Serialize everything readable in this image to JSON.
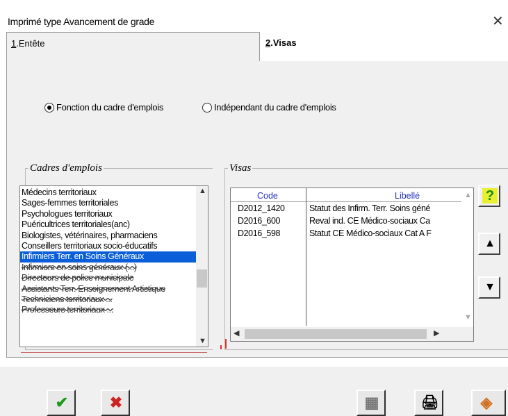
{
  "window": {
    "title": "Imprimé type Avancement de grade",
    "close_glyph": "✕"
  },
  "tabs": [
    {
      "mnemonic": "1",
      "label": ".Entête",
      "active": false
    },
    {
      "mnemonic": "2",
      "label": ".Visas",
      "active": true
    }
  ],
  "radio_options": [
    {
      "label": "Fonction du cadre d'emplois",
      "selected": true
    },
    {
      "label": "Indépendant du cadre d'emplois",
      "selected": false
    }
  ],
  "cadres": {
    "legend": "Cadres d'emplois",
    "items": [
      "Médecins territoriaux",
      "Sages-femmes territoriales",
      "Psychologues territoriaux",
      "Puéricultrices territoriales(anc)",
      "Biologistes, vétérinaires, pharmaciens",
      "Conseillers territoriaux socio-éducatifs",
      "Infirmiers Terr. en Soins Généraux",
      "Infirmiers en soins généraux (...)",
      "Directeurs de police municipale",
      "Assistants Terr. Enseignement Artistique",
      "Techniciens territoriaux ...",
      "Professeurs territoriaux ..."
    ],
    "selected_index": 6,
    "garbled_from_index": 7
  },
  "visas": {
    "legend": "Visas",
    "columns": [
      "Code",
      "Libellé"
    ],
    "rows": [
      {
        "code": "D2012_1420",
        "libelle": "Statut des Infirm. Terr. Soins géné"
      },
      {
        "code": "D2016_600",
        "libelle": "Reval ind. CE Médico-sociaux Ca"
      },
      {
        "code": "D2016_598",
        "libelle": "Statut CE Médico-sociaux Cat A F"
      }
    ]
  },
  "side_buttons": [
    {
      "name": "help",
      "glyph": "?"
    },
    {
      "name": "move-up",
      "glyph": "▲"
    },
    {
      "name": "move-down",
      "glyph": "▼"
    }
  ],
  "bottom_buttons": [
    {
      "name": "validate",
      "glyph": "✔"
    },
    {
      "name": "cancel",
      "glyph": "✖"
    },
    {
      "name": "keyboard",
      "glyph": "▦"
    },
    {
      "name": "print",
      "glyph": "🖨"
    },
    {
      "name": "export",
      "glyph": "◈"
    }
  ],
  "colors": {
    "selection": "#0a5fd8",
    "grid_header": "#2030c0",
    "help": "#1a8a1a",
    "validate": "#1a9a1a",
    "cancel": "#d02020",
    "arrow": "#000000"
  }
}
